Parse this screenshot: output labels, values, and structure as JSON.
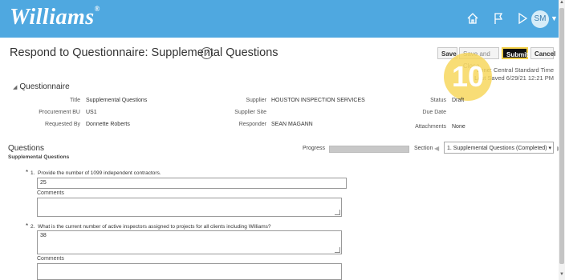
{
  "header": {
    "logo": "Williams",
    "logo_mark": "®",
    "avatar_initials": "SM",
    "icons": [
      "home-icon",
      "flag-icon",
      "play-icon",
      "avatar-chevron-icon"
    ]
  },
  "page": {
    "title": "Respond to Questionnaire: Supplemental Questions",
    "help": "?"
  },
  "toolbar": {
    "save": "Save",
    "save_close": "Save and Close",
    "submit": "Submit",
    "cancel": "Cancel"
  },
  "status_meta": {
    "timezone_partial": "zone: Central Standard Time",
    "last_saved_partial": "Last Saved 6/29/21 12:21 PM"
  },
  "step_badge": "10",
  "questionnaire": {
    "section_title": "Questionnaire",
    "fields": {
      "title_label": "Title",
      "title_value": "Supplemental Questions",
      "procurement_bu_label": "Procurement BU",
      "procurement_bu_value": "US1",
      "requested_by_label": "Requested By",
      "requested_by_value": "Donnette Roberts",
      "supplier_label": "Supplier",
      "supplier_value": "HOUSTON INSPECTION SERVICES",
      "supplier_site_label": "Supplier Site",
      "responder_label": "Responder",
      "responder_value": "SEAN MAGANN",
      "status_label": "Status",
      "status_value": "Draft",
      "due_date_label": "Due Date",
      "attachments_label": "Attachments",
      "attachments_value": "None"
    }
  },
  "questions": {
    "heading": "Questions",
    "subheading": "Supplemental Questions",
    "progress_label": "Progress",
    "progress_fraction": 1.0,
    "section_label": "Section",
    "section_selected": "1. Supplemental Questions (Completed)",
    "items": [
      {
        "required": "*",
        "number": "1.",
        "text": "Provide the number of 1099 independent contractors.",
        "answer": "25",
        "comments_label": "Comments"
      },
      {
        "required": "*",
        "number": "2.",
        "text": "What is the current number of active inspectors assigned to projects for all clients including Williams?",
        "answer": "38",
        "comments_label": "Comments"
      }
    ]
  }
}
